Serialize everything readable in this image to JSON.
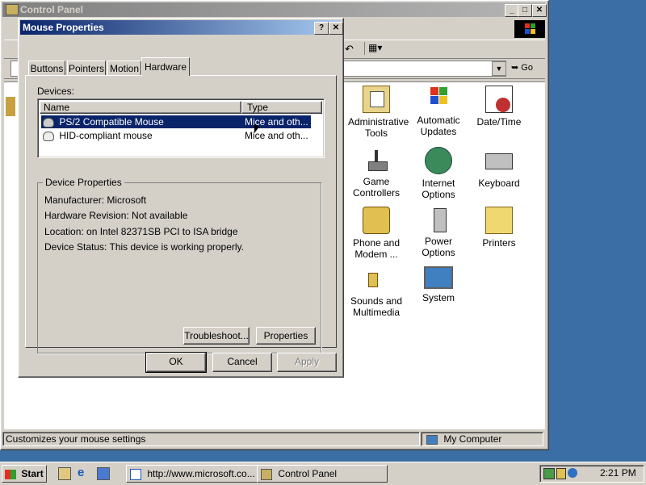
{
  "control_panel": {
    "title": "Control Panel",
    "address_go": "Go",
    "status_left": "Customizes your mouse settings",
    "status_right": "My Computer",
    "icons": [
      {
        "label": "Administrative Tools",
        "icon": "admin-tools-icon"
      },
      {
        "label": "Automatic Updates",
        "icon": "automatic-updates-icon"
      },
      {
        "label": "Date/Time",
        "icon": "date-time-icon"
      },
      {
        "label": "Game Controllers",
        "icon": "game-controllers-icon"
      },
      {
        "label": "Internet Options",
        "icon": "internet-options-icon"
      },
      {
        "label": "Keyboard",
        "icon": "keyboard-icon"
      },
      {
        "label": "Phone and Modem ...",
        "icon": "phone-modem-icon"
      },
      {
        "label": "Power Options",
        "icon": "power-options-icon"
      },
      {
        "label": "Printers",
        "icon": "printers-icon"
      },
      {
        "label": "Sounds and Multimedia",
        "icon": "sounds-multimedia-icon"
      },
      {
        "label": "System",
        "icon": "system-icon"
      }
    ]
  },
  "dialog": {
    "title": "Mouse Properties",
    "help_btn": "?",
    "close_btn": "✕",
    "tabs": [
      "Buttons",
      "Pointers",
      "Motion",
      "Hardware"
    ],
    "active_tab": "Hardware",
    "devices_label": "Devices:",
    "columns": [
      "Name",
      "Type"
    ],
    "devices": [
      {
        "name": "PS/2 Compatible Mouse",
        "type": "Mice and oth..."
      },
      {
        "name": "HID-compliant mouse",
        "type": "Mice and oth..."
      }
    ],
    "device_properties_label": "Device Properties",
    "manufacturer": "Manufacturer: Microsoft",
    "hardware_revision": "Hardware Revision: Not available",
    "location": "Location: on Intel 82371SB PCI to ISA bridge",
    "device_status": "Device Status: This device is working properly.",
    "troubleshoot_btn": "Troubleshoot...",
    "properties_btn": "Properties",
    "ok_btn": "OK",
    "cancel_btn": "Cancel",
    "apply_btn": "Apply"
  },
  "taskbar": {
    "start": "Start",
    "tasks": [
      "http://www.microsoft.co...",
      "Control Panel"
    ],
    "clock": "2:21 PM"
  },
  "colors": {
    "desktop": "#3a6ea5",
    "face": "#d4d0c8",
    "active_title": "#0a246a",
    "selection": "#0a246a"
  }
}
